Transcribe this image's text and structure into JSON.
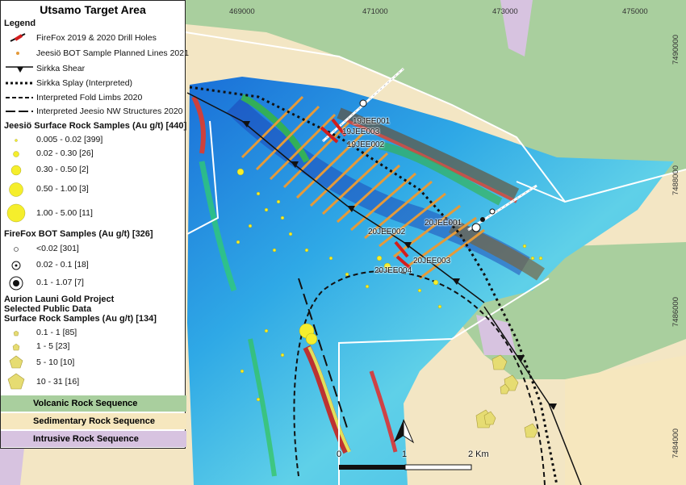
{
  "title": "Utsamo Target Area",
  "legend": {
    "heading": "Legend",
    "items": [
      {
        "label": "FireFox 2019 & 2020 Drill Holes",
        "icon": "drill-hole-icon"
      },
      {
        "label": "Jeesiö BOT Sample Planned Lines 2021",
        "icon": "orange-line-icon"
      },
      {
        "label": "Sirkka Shear",
        "icon": "thrust-line-icon"
      },
      {
        "label": "Sirkka Splay (Interpreted)",
        "icon": "dotted-line-icon"
      },
      {
        "label": "Interpreted Fold Limbs 2020",
        "icon": "dashed-line-icon"
      },
      {
        "label": "Interpreted Jeesio NW Structures 2020",
        "icon": "long-dash-line-icon"
      }
    ],
    "jeesio_heading": "Jeesiö Surface Rock Samples (Au g/t) [440]",
    "jeesio_items": [
      "0.005 - 0.02 [399]",
      "0.02 - 0.30 [26]",
      "0.30 - 0.50 [2]",
      "0.50 - 1.00 [3]",
      "1.00 - 5.00 [11]"
    ],
    "firefox_heading": "FireFox BOT Samples (Au g/t) [326]",
    "firefox_items": [
      "<0.02  [301]",
      "0.02 - 0.1  [18]",
      "0.1 - 1.07  [7]"
    ],
    "aurion_heading1": "Aurion Launi Gold Project",
    "aurion_heading2": "Selected Public Data",
    "aurion_heading3": "Surface Rock Samples (Au g/t) [134]",
    "aurion_items": [
      "0.1 - 1  [85]",
      "1 - 5  [23]",
      "5 - 10  [10]",
      "10 - 31  [16]"
    ],
    "geology": [
      {
        "label": "Volcanic Rock Sequence",
        "color": "#a9cf9e"
      },
      {
        "label": "Sedimentary Rock Sequence",
        "color": "#f6e7be"
      },
      {
        "label": "Intrusive Rock Sequence",
        "color": "#d7c3e0"
      }
    ]
  },
  "grid": {
    "eastings": [
      "469000",
      "471000",
      "473000",
      "475000"
    ],
    "northings": [
      "7490000",
      "7488000",
      "7486000",
      "7484000"
    ]
  },
  "drill_holes": [
    "19JEE001",
    "19JEE003",
    "19JEE002",
    "20JEE001",
    "20JEE002",
    "20JEE003",
    "20JEE004"
  ],
  "scale_bar": {
    "labels": [
      "0",
      "1",
      "2 Km"
    ]
  },
  "north_arrow": "north-arrow-icon"
}
